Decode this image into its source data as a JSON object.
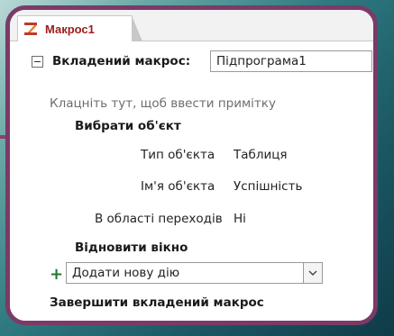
{
  "tab": {
    "label": "Макрос1",
    "icon": "macro-icon"
  },
  "submacro": {
    "label": "Вкладений макрос:",
    "name_value": "Підпрограма1"
  },
  "comment_placeholder": "Клацніть тут, щоб ввести примітку",
  "select_object": {
    "action": "Вибрати об'єкт",
    "object_type_label": "Тип об'єкта",
    "object_type_value": "Таблиця",
    "object_name_label": "Ім'я об'єкта",
    "object_name_value": "Успішність",
    "in_nav_pane_label": "В області переходів",
    "in_nav_pane_value": "Ні"
  },
  "restore_window": "Відновити вікно",
  "add_action": {
    "value": "Додати нову дію"
  },
  "end_submacro": "Завершити вкладений макрос",
  "colors": {
    "frame": "#7b3a67",
    "tab_text": "#9b1c1c",
    "plus": "#1f7a2e"
  }
}
